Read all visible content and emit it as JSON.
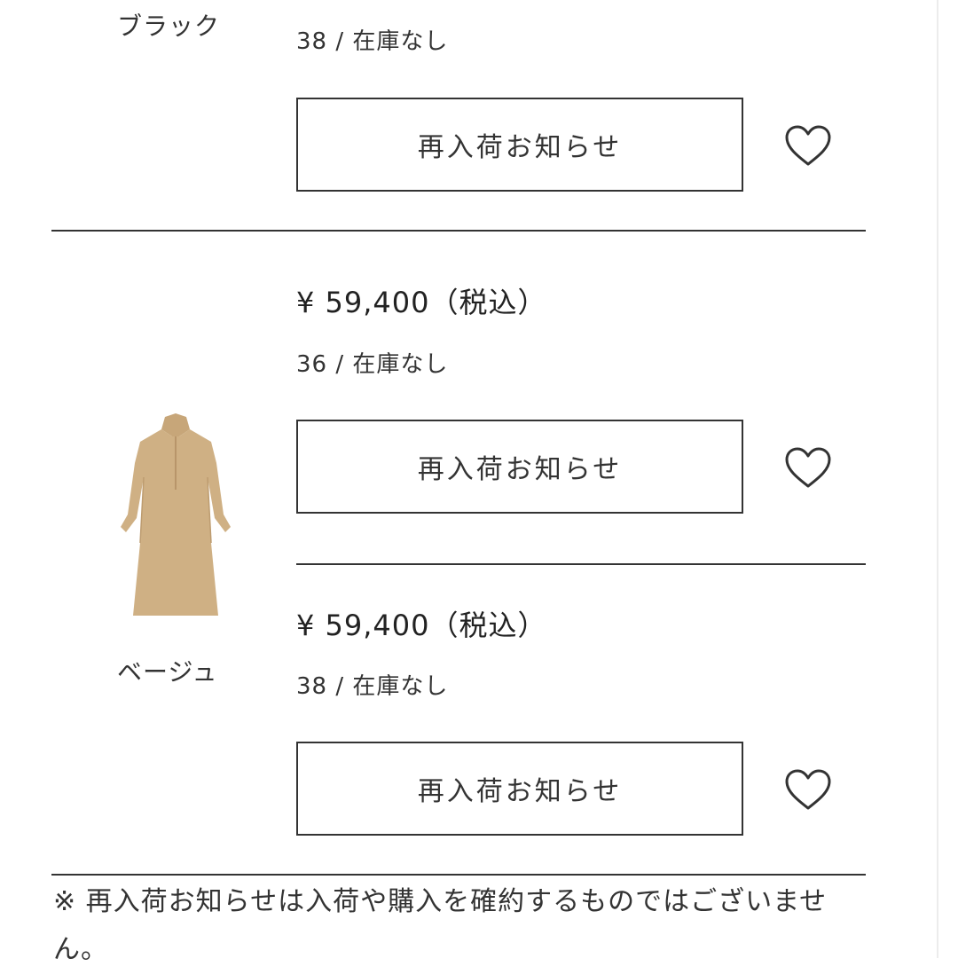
{
  "variants": [
    {
      "color": "ブラック",
      "sizes": [
        {
          "stock_text": "38 / 在庫なし",
          "notify_label": "再入荷お知らせ"
        }
      ]
    },
    {
      "color": "ベージュ",
      "image_icon": "beige-shirt-dress-image",
      "sizes": [
        {
          "price": "¥ 59,400（税込）",
          "stock_text": "36 / 在庫なし",
          "notify_label": "再入荷お知らせ"
        },
        {
          "price": "¥ 59,400（税込）",
          "stock_text": "38 / 在庫なし",
          "notify_label": "再入荷お知らせ"
        }
      ]
    }
  ],
  "favorite_icon": "heart-outline-icon",
  "notice_text": "※ 再入荷お知らせは入荷や購入を確約するものではございません。",
  "colors": {
    "text": "#222222",
    "border": "#333333",
    "product": "#cfb084"
  }
}
